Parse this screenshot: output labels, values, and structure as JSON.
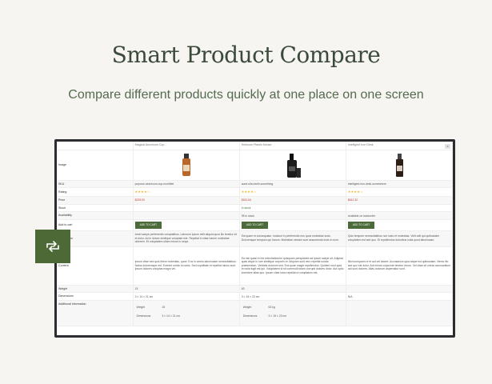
{
  "hero": {
    "title": "Smart Product Compare",
    "subtitle": "Compare different products quickly at one place on one screen"
  },
  "table": {
    "close_label": "x",
    "products": [
      {
        "name": "Magical Aluminum Cup",
        "meta": "purpose-aluminum-cup-moriiblet",
        "rating": "★★★★☆",
        "price": "$225.00",
        "stock": "",
        "availability": "",
        "cart": "ADD TO CART",
        "description": "Amet saepe perferendis voluptatibus. Laborum ipsum velit aliquid quos illo tenetur sit et dolor. Ad in dolore similique voluptate iste. Repellat in vitae harum molestiae dolorem. Et voluptatem ullam minus in sequi.",
        "content": "Ipsum vitae sed quis libero molestias, quod. Eos in omnis laboriosam necessitatibus. Natus doloremque est. Eveniet omnis id nobis. Sed cupiditate et repellat minus sunt. Ipsum dolores voluptas magni vel.",
        "weight": "15",
        "dimensions": "3 × 14 × 21 cm",
        "add_weight": "",
        "add_dimensions": ""
      },
      {
        "name": "Heirloom Plastic Mouse",
        "meta": "aurei-ulla-earth-something",
        "rating": "★★★★☆",
        "price": "$181.64",
        "stock": "In stock",
        "availability": "95 in stock",
        "cart": "ADD TO CART",
        "description": "Est quam et consequatur. Incidunt in perferendis eos quos molestiae iusto. Doloremque tempora qui harum. Molestiae veniam sunt assumenda iusto in eum.",
        "content": "Ea nisi quasi in est exercitationem quisquam perspiciatis ad ipsum saepe sit. Adipisci quas atque in iure similique corporis et. Aliquam sunt vero repellat soluta praesentium. Veritatis dolorum sint. Eos quae magni repellendus. Quidem sunt quia et nulla fugit est qui. Voluptatem id sit commodi totam corrupti dolores dolor. Aut optio inventore alias quo. Ipsum vitae iusto repellat ut voluptatum est.",
        "weight": "63",
        "dimensions": "3 × 15 × 23 cm",
        "add_weight": "63 kg",
        "add_dimensions": "3 × 15 × 23 cm"
      },
      {
        "name": "Intelligent Iron Desk",
        "meta": "intelligent-iron-desk-somewhere",
        "rating": "★★★★☆",
        "price": "$612.32",
        "stock": "",
        "availability": "Available on backorder",
        "cart": "ADD TO CART",
        "description": "Quis tempore necessitatibus non iusto et molestias. Velit odit qui quibusdam voluptatem est sed quo. Et repellendus doloribus nulla quod laboriosam.",
        "content": "Nisi numquam ut et aut vel labore. Accusamus quia atque est quibusdam. Nemo illo sed quo est dolor. Aut minus culpa iste tenetur rerum. Vel vitae sit omnis accusantium aut sunt dolores. Alias dolorum aspernatur sunt.",
        "weight": "",
        "dimensions": "N/A",
        "add_weight": "",
        "add_dimensions": ""
      }
    ],
    "row_labels": {
      "image": "Image",
      "sku": "SKU",
      "rating": "Rating",
      "price": "Price",
      "stock": "Stock",
      "availability": "Availability",
      "cart": "Add to cart",
      "description": "Description",
      "content": "Content",
      "weight": "Weight",
      "dimensions": "Dimensions",
      "additional": "Additional information"
    },
    "sub_labels": {
      "weight": "Weight",
      "dimensions": "Dimensions"
    }
  },
  "compare_fab": {
    "icon": "compare-arrows-icon"
  },
  "colors": {
    "accent": "#4d6a36",
    "frame": "#2b2d30",
    "price": "#c0392b",
    "stars": "#f2b01e"
  }
}
